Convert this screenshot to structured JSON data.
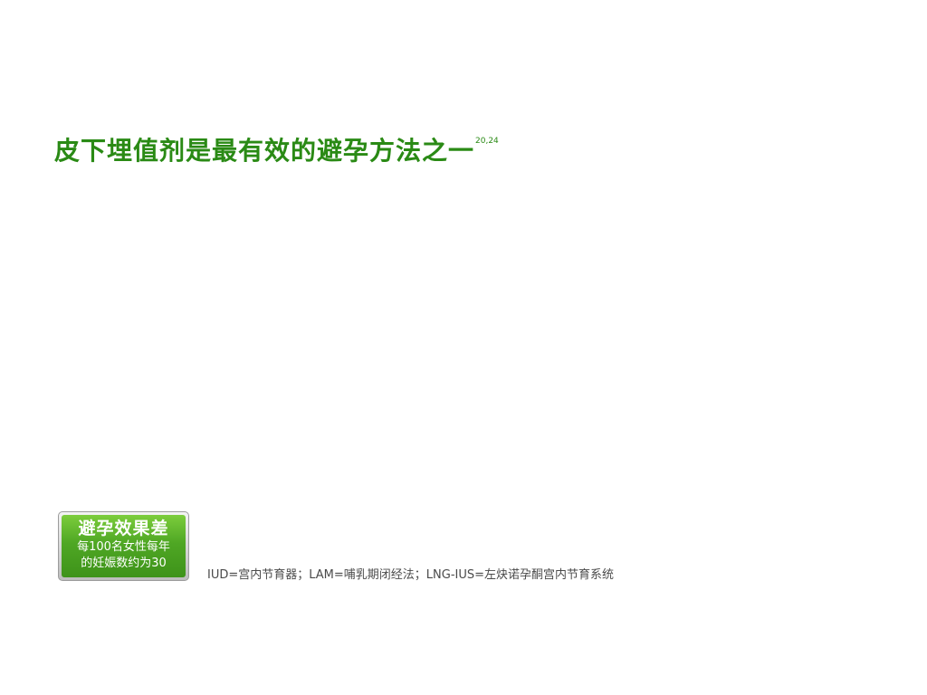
{
  "slide": {
    "title": "皮下埋值剂是最有效的避孕方法之一",
    "title_reference": "20,24",
    "badge": {
      "heading": "避孕效果差",
      "line1": "每100名女性每年",
      "line2": "的妊娠数约为30"
    },
    "legend": "IUD=宫内节育器；LAM=哺乳期闭经法；LNG-IUS=左炔诺孕酮宫内节育系统"
  },
  "colors": {
    "title_green": "#2a8a15",
    "badge_green_top": "#7ccd3c",
    "badge_green_bottom": "#3e931a",
    "badge_frame": "#bdbdbd",
    "legend_text": "#4a4a4a"
  }
}
